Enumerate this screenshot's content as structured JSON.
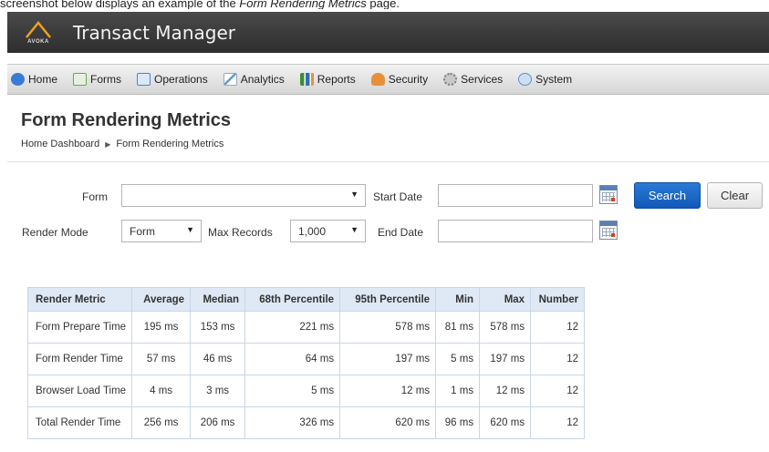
{
  "caption": {
    "prefix": "screenshot below displays an example of the ",
    "emphasis": "Form Rendering Metrics",
    "suffix": " page."
  },
  "app": {
    "logo_text": "AVOKA",
    "title": "Transact Manager"
  },
  "nav": {
    "items": [
      {
        "label": "Home",
        "icon": "home-icon",
        "color": "#3a7bd5"
      },
      {
        "label": "Forms",
        "icon": "forms-icon",
        "color": "#6aa84f"
      },
      {
        "label": "Operations",
        "icon": "operations-icon",
        "color": "#4a86c8"
      },
      {
        "label": "Analytics",
        "icon": "analytics-icon",
        "color": "#5b9bd5"
      },
      {
        "label": "Reports",
        "icon": "reports-icon",
        "color": "#3c8d3c"
      },
      {
        "label": "Security",
        "icon": "security-icon",
        "color": "#e69138"
      },
      {
        "label": "Services",
        "icon": "services-icon",
        "color": "#7f7f7f"
      },
      {
        "label": "System",
        "icon": "system-icon",
        "color": "#5a8fd0"
      }
    ]
  },
  "page": {
    "title": "Form Rendering Metrics",
    "breadcrumb": [
      "Home Dashboard",
      "Form Rendering Metrics"
    ]
  },
  "filters": {
    "form_label": "Form",
    "form_value": "",
    "render_mode_label": "Render Mode",
    "render_mode_value": "Form",
    "max_records_label": "Max Records",
    "max_records_value": "1,000",
    "start_date_label": "Start Date",
    "start_date_value": "",
    "end_date_label": "End Date",
    "end_date_value": "",
    "search_label": "Search",
    "clear_label": "Clear"
  },
  "table": {
    "headers": [
      "Render Metric",
      "Average",
      "Median",
      "68th Percentile",
      "95th Percentile",
      "Min",
      "Max",
      "Number"
    ],
    "rows": [
      [
        "Form Prepare Time",
        "195 ms",
        "153 ms",
        "221 ms",
        "578 ms",
        "81 ms",
        "578 ms",
        "12"
      ],
      [
        "Form Render Time",
        "57 ms",
        "46 ms",
        "64 ms",
        "197 ms",
        "5 ms",
        "197 ms",
        "12"
      ],
      [
        "Browser Load Time",
        "4 ms",
        "3 ms",
        "5 ms",
        "12 ms",
        "1 ms",
        "12 ms",
        "12"
      ],
      [
        "Total Render Time",
        "256 ms",
        "206 ms",
        "326 ms",
        "620 ms",
        "96 ms",
        "620 ms",
        "12"
      ]
    ]
  },
  "colors": {
    "accent": "#1a64c4",
    "header_bg": "#dfe9f5"
  }
}
